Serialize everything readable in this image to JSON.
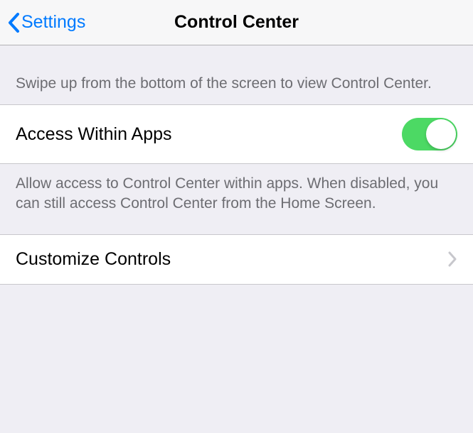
{
  "nav": {
    "back_label": "Settings",
    "title": "Control Center"
  },
  "intro": {
    "text": "Swipe up from the bottom of the screen to view Control Center."
  },
  "access_toggle": {
    "label": "Access Within Apps",
    "footer": "Allow access to Control Center within apps. When disabled, you can still access Control Center from the Home Screen.",
    "value": true
  },
  "customize": {
    "label": "Customize Controls"
  }
}
